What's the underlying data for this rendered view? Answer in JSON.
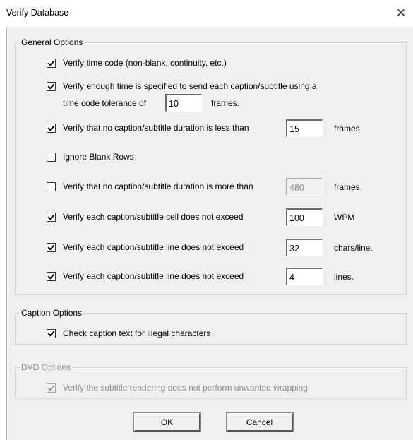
{
  "window": {
    "title": "Verify Database",
    "close_glyph": "✕"
  },
  "general": {
    "legend": "General Options",
    "time_code": {
      "label": "Verify time code (non-blank, continuity, etc.)",
      "checked": true
    },
    "enough_time": {
      "label_line1": "Verify enough time is specified to send each caption/subtitle using a",
      "label_line2_prefix": "time code tolerance of",
      "value": "10",
      "unit": "frames.",
      "checked": true
    },
    "min_duration": {
      "label": "Verify that no caption/subtitle duration is less than",
      "value": "15",
      "unit": "frames.",
      "checked": true
    },
    "ignore_blank": {
      "label": "Ignore Blank Rows",
      "checked": false
    },
    "max_duration": {
      "label": "Verify that no caption/subtitle duration is more than",
      "value": "480",
      "unit": "frames.",
      "checked": false
    },
    "wpm": {
      "label": "Verify each caption/subtitle cell does not exceed",
      "value": "100",
      "unit": "WPM",
      "checked": true
    },
    "chars_line": {
      "label": "Verify each caption/subtitle line does not exceed",
      "value": "32",
      "unit": "chars/line.",
      "checked": true
    },
    "lines": {
      "label": "Verify each caption/subtitle line does not exceed",
      "value": "4",
      "unit": "lines.",
      "checked": true
    }
  },
  "caption": {
    "legend": "Caption Options",
    "illegal_chars": {
      "label": "Check caption text for illegal characters",
      "checked": true
    }
  },
  "dvd": {
    "legend": "DVD Options",
    "wrapping": {
      "label": "Verify the subtitle rendering does not perform unwanted wrapping",
      "checked": true
    }
  },
  "buttons": {
    "ok": "OK",
    "cancel": "Cancel"
  }
}
